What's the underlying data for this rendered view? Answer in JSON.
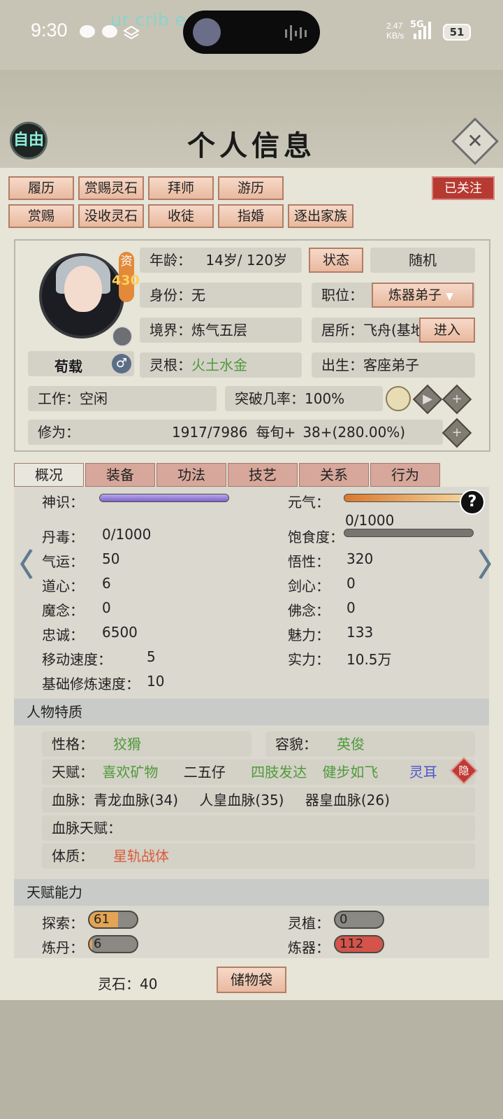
{
  "status_bar": {
    "time": "9:30",
    "ghost_text": "ur crib e",
    "net_speed": "2.47",
    "net_unit": "KB/s",
    "network": "5G",
    "battery": "51"
  },
  "header": {
    "mode_badge": "自由",
    "title": "个人信息",
    "close_icon": "close-icon"
  },
  "actions": {
    "row1": [
      "履历",
      "赏赐灵石",
      "拜师",
      "游历"
    ],
    "row2": [
      "赏赐",
      "没收灵石",
      "收徒",
      "指婚",
      "逐出家族"
    ],
    "follow": "已关注"
  },
  "profile": {
    "aptitude_label": "资",
    "aptitude_value": "430",
    "name": "荀载",
    "gender_symbol": "♂",
    "age_label": "年龄：",
    "age_value": "14岁/ 120岁",
    "status_button": "状态",
    "random_button": "随机",
    "identity_label": "身份：",
    "identity_value": "无",
    "position_label": "职位：",
    "position_value": "炼器弟子",
    "realm_label": "境界：",
    "realm_value": "炼气五层",
    "residence_label": "居所：",
    "residence_value": "飞舟(基地",
    "enter_button": "进入",
    "root_label": "灵根：",
    "root_value": "火土水金",
    "birth_label": "出生：",
    "birth_value": "客座弟子",
    "work_label": "工作：",
    "work_value": "空闲",
    "breakthrough_label": "突破几率：",
    "breakthrough_value": "100%",
    "cultivation_label": "修为：",
    "cultivation_value": "1917/7986",
    "per_label": "每旬+",
    "per_value": "38+(280.00%)"
  },
  "tabs": [
    "概况",
    "装备",
    "功法",
    "技艺",
    "关系",
    "行为"
  ],
  "stats": {
    "shenshi_label": "神识：",
    "shenshi_fill": 1.0,
    "yuanqi_label": "元气：",
    "yuanqi_fill": 1.0,
    "satiety_value": "0/1000",
    "satiety_label": "饱食度：",
    "satiety_fill": 0.0,
    "left": [
      {
        "label": "丹毒：",
        "value": "0/1000"
      },
      {
        "label": "气运：",
        "value": "50"
      },
      {
        "label": "道心：",
        "value": "6"
      },
      {
        "label": "魔念：",
        "value": "0"
      },
      {
        "label": "忠诚：",
        "value": "6500"
      },
      {
        "label": "移动速度：",
        "value": "5"
      },
      {
        "label": "基础修炼速度：",
        "value": "10"
      }
    ],
    "right": [
      {
        "label": "悟性：",
        "value": "320"
      },
      {
        "label": "剑心：",
        "value": "0"
      },
      {
        "label": "佛念：",
        "value": "0"
      },
      {
        "label": "魅力：",
        "value": "133"
      },
      {
        "label": "实力：",
        "value": "10.5万"
      }
    ]
  },
  "traits": {
    "section_title": "人物特质",
    "personality_label": "性格：",
    "personality_value": "狡猾",
    "appearance_label": "容貌：",
    "appearance_value": "英俊",
    "talent_label": "天赋：",
    "talents": [
      "喜欢矿物",
      "二五仔",
      "四肢发达",
      "健步如飞",
      "灵耳"
    ],
    "hide_badge": "隐",
    "bloodline_label": "血脉：",
    "bloodlines": [
      "青龙血脉(34)",
      "人皇血脉(35)",
      "器皇血脉(26)"
    ],
    "bloodline_talent_label": "血脉天赋：",
    "physique_label": "体质：",
    "physique_value": "星轨战体"
  },
  "abilities": {
    "section_title": "天赋能力",
    "items": [
      {
        "label": "探索：",
        "value": "61",
        "fill": 0.61
      },
      {
        "label": "灵植：",
        "value": "0",
        "fill": 0.0
      },
      {
        "label": "炼丹：",
        "value": "6",
        "fill": 0.06
      },
      {
        "label": "炼器：",
        "value": "112",
        "fill": 1.0
      }
    ]
  },
  "footer": {
    "spirit_stone_label": "灵石：",
    "spirit_stone_value": "40",
    "bag_button": "储物袋"
  },
  "colors": {
    "accent": "#e9b99f",
    "follow": "#b63a32",
    "green_text": "#4f9a3a",
    "blue_text": "#4a57c9",
    "red_text": "#d95c3a",
    "purple_bar": "#8f7bd0",
    "orange_bar": "#e08a3a"
  }
}
